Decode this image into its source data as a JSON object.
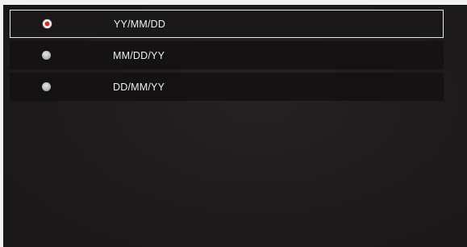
{
  "date_format_options": [
    {
      "label": "YY/MM/DD",
      "selected": true
    },
    {
      "label": "MM/DD/YY",
      "selected": false
    },
    {
      "label": "DD/MM/YY",
      "selected": false
    }
  ],
  "colors": {
    "background": "#1d1b1c",
    "row_background": "#141213",
    "selection_border": "#e8e8e8",
    "radio_selected": "#d82a1e",
    "text": "#f0f0f0"
  }
}
